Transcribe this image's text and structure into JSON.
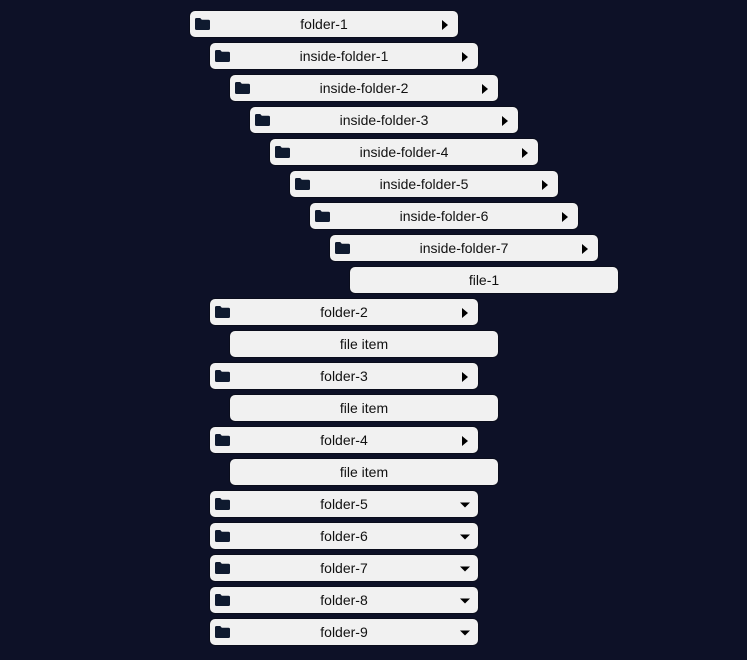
{
  "tree": {
    "items": [
      {
        "label": "folder-1",
        "kind": "folder",
        "icon": "folder-icon",
        "arrow": "right"
      },
      {
        "label": "inside-folder-1",
        "kind": "folder",
        "icon": "folder-icon",
        "arrow": "right"
      },
      {
        "label": "inside-folder-2",
        "kind": "folder",
        "icon": "folder-icon",
        "arrow": "right"
      },
      {
        "label": "inside-folder-3",
        "kind": "folder",
        "icon": "folder-icon",
        "arrow": "right"
      },
      {
        "label": "inside-folder-4",
        "kind": "folder",
        "icon": "folder-icon",
        "arrow": "right"
      },
      {
        "label": "inside-folder-5",
        "kind": "folder",
        "icon": "folder-icon",
        "arrow": "right"
      },
      {
        "label": "inside-folder-6",
        "kind": "folder",
        "icon": "folder-icon",
        "arrow": "right"
      },
      {
        "label": "inside-folder-7",
        "kind": "folder",
        "icon": "folder-icon",
        "arrow": "right"
      },
      {
        "label": "file-1",
        "kind": "file"
      },
      {
        "label": "folder-2",
        "kind": "folder",
        "icon": "folder-icon",
        "arrow": "right"
      },
      {
        "label": "file item",
        "kind": "file"
      },
      {
        "label": "folder-3",
        "kind": "folder",
        "icon": "folder-icon",
        "arrow": "right"
      },
      {
        "label": "file item",
        "kind": "file"
      },
      {
        "label": "folder-4",
        "kind": "folder",
        "icon": "folder-icon",
        "arrow": "right"
      },
      {
        "label": "file item",
        "kind": "file"
      },
      {
        "label": "folder-5",
        "kind": "folder",
        "icon": "folder-icon",
        "arrow": "down"
      },
      {
        "label": "folder-6",
        "kind": "folder",
        "icon": "folder-icon",
        "arrow": "down"
      },
      {
        "label": "folder-7",
        "kind": "folder",
        "icon": "folder-icon",
        "arrow": "down"
      },
      {
        "label": "folder-8",
        "kind": "folder",
        "icon": "folder-icon",
        "arrow": "down"
      },
      {
        "label": "folder-9",
        "kind": "folder",
        "icon": "folder-icon",
        "arrow": "down"
      }
    ]
  },
  "colors": {
    "background": "#0d1127",
    "row_background": "#f1f1f1",
    "icon": "#0f1a2f",
    "text": "#111111"
  }
}
